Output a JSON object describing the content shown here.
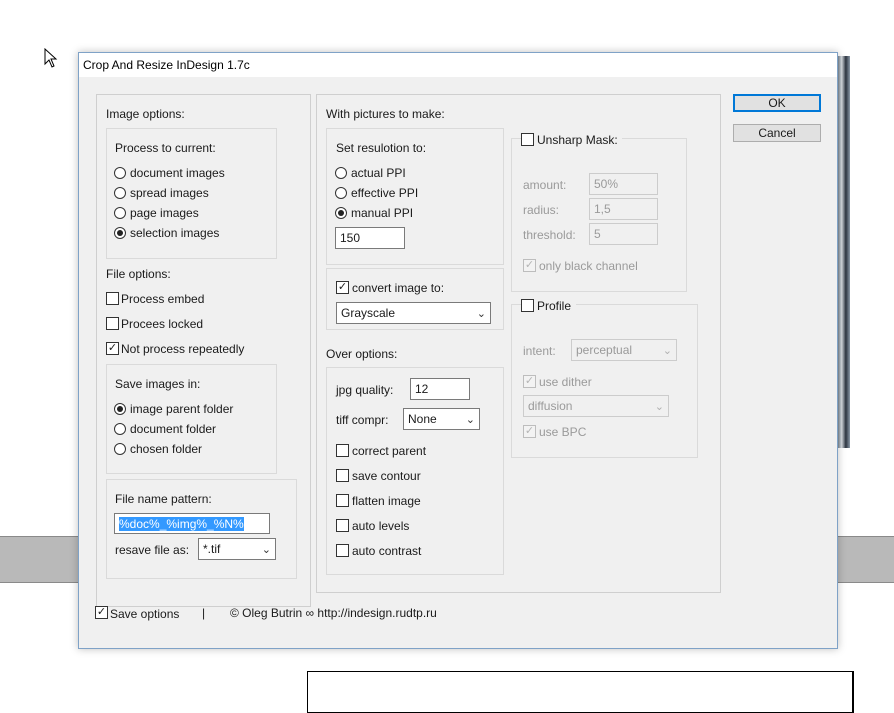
{
  "dialog": {
    "title": "Crop And Resize InDesign 1.7c",
    "ok_label": "OK",
    "cancel_label": "Cancel"
  },
  "image_options": {
    "heading": "Image options:",
    "process_heading": "Process to current:",
    "process_options": [
      "document images",
      "spread images",
      "page images",
      "selection images"
    ],
    "process_selected": "selection images"
  },
  "file_options": {
    "heading": "File options:",
    "process_embed": {
      "label": "Process embed",
      "checked": false
    },
    "process_locked": {
      "label": "Procees locked",
      "checked": false
    },
    "not_repeated": {
      "label": "Not process repeatedly",
      "checked": true
    }
  },
  "save_images": {
    "heading": "Save images in:",
    "options": [
      "image parent folder",
      "document folder",
      "chosen folder"
    ],
    "selected": "image parent folder"
  },
  "file_name": {
    "heading": "File name pattern:",
    "pattern": "%doc%_%img%_%N%",
    "resave_label": "resave file as:",
    "resave_value": "*.tif"
  },
  "pictures": {
    "heading": "With pictures to make:",
    "resolution_heading": "Set resulotion to:",
    "resolution_options": [
      "actual PPI",
      "effective PPI",
      "manual PPI"
    ],
    "resolution_selected": "manual PPI",
    "manual_ppi": "150",
    "convert": {
      "label": "convert image to:",
      "checked": true,
      "value": "Grayscale"
    }
  },
  "over_options": {
    "heading": "Over options:",
    "jpg_label": "jpg quality:",
    "jpg_value": "12",
    "tiff_label": "tiff compr:",
    "tiff_value": "None",
    "checks": [
      {
        "label": "correct parent",
        "checked": false
      },
      {
        "label": "save contour",
        "checked": false
      },
      {
        "label": "flatten image",
        "checked": false
      },
      {
        "label": "auto levels",
        "checked": false
      },
      {
        "label": "auto contrast",
        "checked": false
      }
    ]
  },
  "unsharp": {
    "label": "Unsharp Mask:",
    "checked": false,
    "amount_label": "amount:",
    "amount_value": "50%",
    "radius_label": "radius:",
    "radius_value": "1,5",
    "threshold_label": "threshold:",
    "threshold_value": "5",
    "black_channel_label": "only black channel",
    "black_channel_checked": true
  },
  "profile": {
    "label": "Profile",
    "checked": false,
    "intent_label": "intent:",
    "intent_value": "perceptual",
    "dither_label": "use dither",
    "dither_checked": true,
    "dither_value": "diffusion",
    "bpc_label": "use BPC",
    "bpc_checked": true
  },
  "footer": {
    "save_options_label": "Save options",
    "save_options_checked": true,
    "separator": "|",
    "copyright": "© Oleg Butrin ∞ http://indesign.rudtp.ru"
  },
  "icons": {
    "cursor": "mouse-pointer-icon",
    "check": "✓",
    "chevron": "⌄"
  }
}
